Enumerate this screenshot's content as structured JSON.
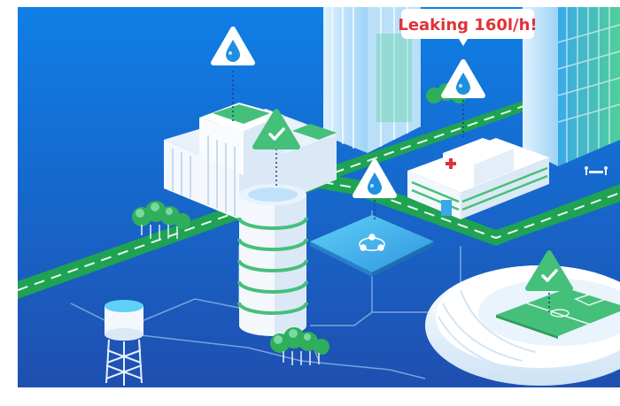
{
  "callout": {
    "text": "Leaking 160l/h!"
  },
  "colors": {
    "sky_top": "#0f7fe6",
    "sky_bottom": "#1f4fb0",
    "road": "#1fa352",
    "road_dash": "#e9f6ee",
    "building": "#f4f8fc",
    "building_shadow": "#cfe0f1",
    "accent_green": "#45c07a",
    "accent_blue": "#3aa9e8",
    "alert_red": "#e0323a"
  },
  "icons": {
    "water_marker": "water-drop-icon",
    "check_marker": "checkmark-icon",
    "hospital_cross": "red-cross-icon",
    "meeting": "meeting-people-icon",
    "hub": "network-hub-icon"
  }
}
